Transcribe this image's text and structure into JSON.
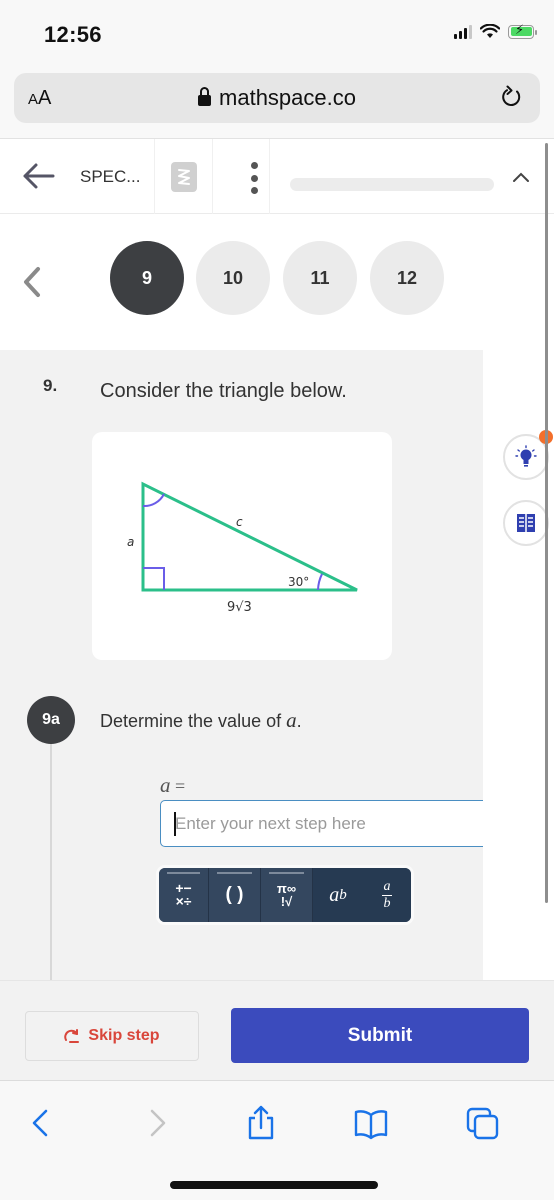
{
  "status_bar": {
    "time": "12:56"
  },
  "browser": {
    "text_size_label": "AA",
    "url": "mathspace.co",
    "icons": {
      "lock": "lock-icon",
      "reload": "reload-icon"
    }
  },
  "app_header": {
    "title": "SPEC...",
    "progress": 0,
    "icons": {
      "back": "arrow-left-icon",
      "logo": "mathspace-logo-icon",
      "menu": "kebab-menu-icon",
      "collapse": "chevron-up-icon"
    }
  },
  "pager": {
    "items": [
      {
        "label": "9",
        "active": true
      },
      {
        "label": "10",
        "active": false
      },
      {
        "label": "11",
        "active": false
      },
      {
        "label": "12",
        "active": false
      }
    ]
  },
  "question": {
    "number": "9.",
    "text": "Consider the triangle below.",
    "figure": {
      "side_vertical": "a",
      "side_hypotenuse": "c",
      "side_base": "9√3",
      "angle_label": "30°"
    }
  },
  "step": {
    "badge": "9a",
    "text_prefix": "Determine the value of ",
    "text_var": "a",
    "text_suffix": ".",
    "answer_label_var": "a",
    "answer_label_eq": " =",
    "input_value": "",
    "input_placeholder": "Enter your next step here"
  },
  "math_toolbar": {
    "buttons": [
      {
        "name": "operators",
        "label_top": "+−",
        "label_bottom": "×÷"
      },
      {
        "name": "brackets",
        "label": "( )"
      },
      {
        "name": "symbols",
        "label_top": "π∞",
        "label_bottom": "!√"
      },
      {
        "name": "power",
        "base": "a",
        "exp": "b"
      },
      {
        "name": "fraction",
        "num": "a",
        "den": "b"
      }
    ]
  },
  "right_rail": {
    "hint_icon": "lightbulb-icon",
    "book_icon": "worked-example-book-icon",
    "hint_has_notification": true
  },
  "actions": {
    "skip_label": "Skip step",
    "submit_label": "Submit"
  },
  "colors": {
    "primary": "#3b4bbd",
    "skip_red": "#d9463b",
    "triangle_green": "#2bbf8a",
    "angle_purple": "#6a5de8",
    "notification": "#f36f2b",
    "safari_blue": "#1a73e8"
  }
}
